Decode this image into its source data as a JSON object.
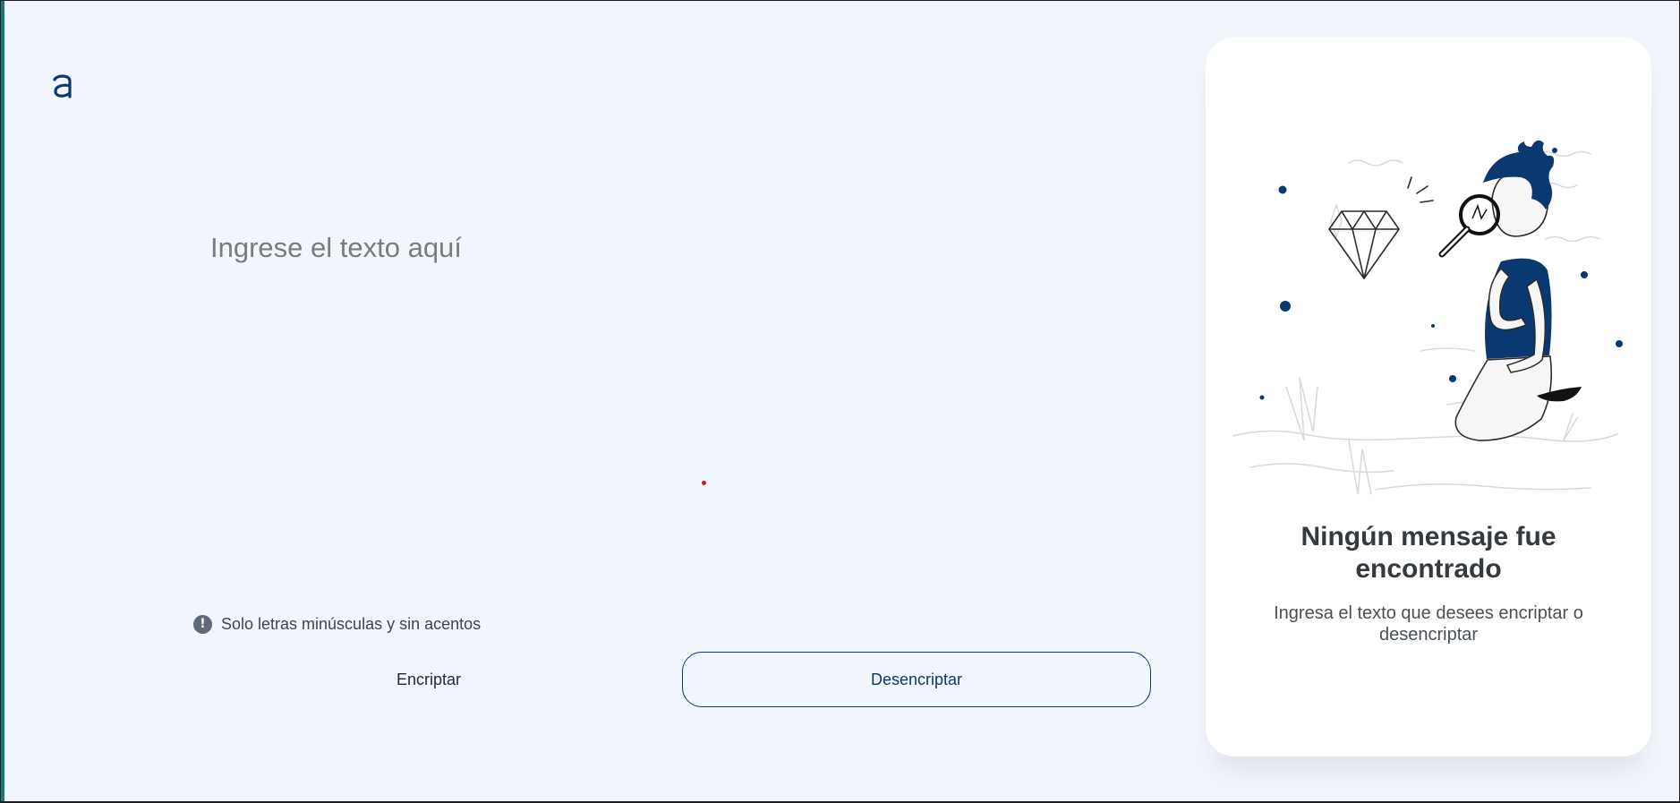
{
  "app": {
    "logo_icon": "alura-a-logo-icon",
    "accent_color": "#0a3871",
    "background_color": "#f2f5fc"
  },
  "input": {
    "placeholder": "Ingrese el texto aquí",
    "value": ""
  },
  "hint": {
    "icon": "exclamation-circle-icon",
    "text": "Solo letras minúsculas y sin acentos"
  },
  "buttons": {
    "encrypt_label": "Encriptar",
    "decrypt_label": "Desencriptar"
  },
  "result_panel": {
    "illustration": "person-with-magnifying-glass-illustration",
    "title": "Ningún mensaje fue encontrado",
    "text": "Ingresa el texto que desees encriptar o desencriptar"
  }
}
